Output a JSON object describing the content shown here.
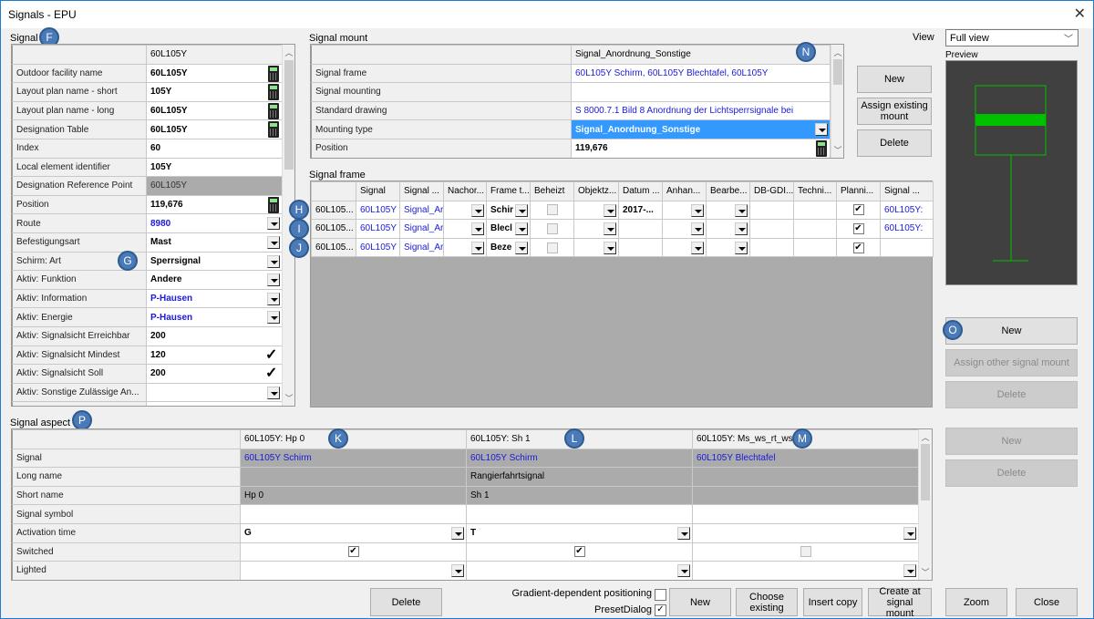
{
  "window": {
    "title": "Signals - EPU",
    "close_icon": "close-icon"
  },
  "signal": {
    "label": "Signal",
    "badge": "F",
    "header_value": "60L105Y",
    "rows": [
      {
        "label": "Outdoor facility name",
        "value": "60L105Y",
        "control": "calc"
      },
      {
        "label": "Layout plan name - short",
        "value": "105Y",
        "control": "calc"
      },
      {
        "label": "Layout plan name - long",
        "value": "60L105Y",
        "control": "calc"
      },
      {
        "label": "Designation Table",
        "value": "60L105Y",
        "control": "calc"
      },
      {
        "label": "Index",
        "value": "60",
        "control": ""
      },
      {
        "label": "Local element identifier",
        "value": "105Y",
        "control": ""
      },
      {
        "label": "Designation Reference Point",
        "value": "60L105Y",
        "control": "readonly"
      },
      {
        "label": "Position",
        "value": "119,676",
        "control": "calc"
      },
      {
        "label": "Route",
        "value": "8980",
        "control": "dropdown",
        "link": true
      },
      {
        "label": "Befestigungsart",
        "value": "Mast",
        "control": "dropdown"
      },
      {
        "label": "Schirm: Art",
        "value": "Sperrsignal",
        "control": "dropdown"
      },
      {
        "label": "Aktiv: Funktion",
        "value": "Andere",
        "control": "dropdown"
      },
      {
        "label": "Aktiv: Information",
        "value": "P-Hausen",
        "control": "dropdown",
        "link": true
      },
      {
        "label": "Aktiv: Energie",
        "value": "P-Hausen",
        "control": "dropdown",
        "link": true
      },
      {
        "label": "Aktiv: Signalsicht Erreichbar",
        "value": "200",
        "control": ""
      },
      {
        "label": "Aktiv: Signalsicht Mindest",
        "value": "120",
        "control": "check"
      },
      {
        "label": "Aktiv: Signalsicht Soll",
        "value": "200",
        "control": "check"
      },
      {
        "label": "Aktiv: Sonstige Zulässige An...",
        "value": "",
        "control": "dropdown"
      }
    ],
    "badge_g": "G"
  },
  "signal_mount": {
    "label": "Signal mount",
    "badge": "N",
    "header_value": "Signal_Anordnung_Sonstige",
    "rows": [
      {
        "label": "Signal frame",
        "value": "60L105Y Schirm, 60L105Y Blechtafel, 60L105Y"
      },
      {
        "label": "Signal mounting",
        "value": ""
      },
      {
        "label": "Standard drawing",
        "value": "S 8000.7.1 Bild 8 Anordnung der Lichtsperrsignale bei"
      },
      {
        "label": "Mounting type",
        "value": "Signal_Anordnung_Sonstige"
      },
      {
        "label": "Position",
        "value": "119,676"
      }
    ],
    "buttons": {
      "new": "New",
      "assign": "Assign existing mount",
      "delete": "Delete"
    }
  },
  "view": {
    "label": "View",
    "selected": "Full view",
    "preview_label": "Preview"
  },
  "signal_frame": {
    "label": "Signal frame",
    "columns": [
      "",
      "Signal",
      "Signal ...",
      "Nachor...",
      "Frame t...",
      "Beheizt",
      "Objektz...",
      "Datum ...",
      "Anhan...",
      "Bearbe...",
      "DB-GDI...",
      "Techni...",
      "Planni...",
      "Signal ..."
    ],
    "rows": [
      {
        "badge": "H",
        "name": "60L105...",
        "signal": "60L105Y",
        "signal2": "Signal_Ar",
        "frame": "Schir",
        "datum": "2017-...",
        "planning": true,
        "signal_end": "60L105Y:"
      },
      {
        "badge": "I",
        "name": "60L105...",
        "signal": "60L105Y",
        "signal2": "Signal_Ar",
        "frame": "Blecl",
        "datum": "",
        "planning": true,
        "signal_end": "60L105Y:"
      },
      {
        "badge": "J",
        "name": "60L105...",
        "signal": "60L105Y",
        "signal2": "Signal_Ar",
        "frame": "Beze",
        "datum": "",
        "planning": true,
        "signal_end": ""
      }
    ],
    "buttons": {
      "new": "New",
      "assign": "Assign other signal mount",
      "delete": "Delete"
    },
    "badge_o": "O"
  },
  "signal_aspect": {
    "label": "Signal aspect",
    "badge": "P",
    "columns": [
      {
        "header": "60L105Y: Hp 0",
        "badge": "K",
        "signal": "60L105Y Schirm",
        "long_name": "",
        "short_name": "Hp 0",
        "symbol": "",
        "activation": "G",
        "switched": true,
        "switched_enabled": true
      },
      {
        "header": "60L105Y: Sh 1",
        "badge": "L",
        "signal": "60L105Y Schirm",
        "long_name": "Rangierfahrtsignal",
        "short_name": "Sh 1",
        "symbol": "",
        "activation": "T",
        "switched": true,
        "switched_enabled": true
      },
      {
        "header": "60L105Y: Ms_ws_rt_ws",
        "badge": "M",
        "signal": "60L105Y Blechtafel",
        "long_name": "",
        "short_name": "",
        "symbol": "",
        "activation": "",
        "switched": false,
        "switched_enabled": false
      }
    ],
    "row_labels": [
      "Signal",
      "Long name",
      "Short name",
      "Signal symbol",
      "Activation time",
      "Switched",
      "Lighted"
    ],
    "buttons": {
      "new": "New",
      "delete": "Delete"
    }
  },
  "footer": {
    "delete": "Delete",
    "gradient_label": "Gradient-dependent positioning",
    "gradient_checked": false,
    "preset_label": "PresetDialog",
    "preset_checked": true,
    "new": "New",
    "choose": "Choose existing",
    "insert": "Insert copy",
    "create": "Create at signal mount",
    "zoom": "Zoom",
    "close": "Close"
  },
  "colors": {
    "accent": "#3399ff",
    "link": "#1a1adb",
    "preview_bg": "#404040",
    "preview_line": "#00c000",
    "badge": "#4a7ab8"
  }
}
